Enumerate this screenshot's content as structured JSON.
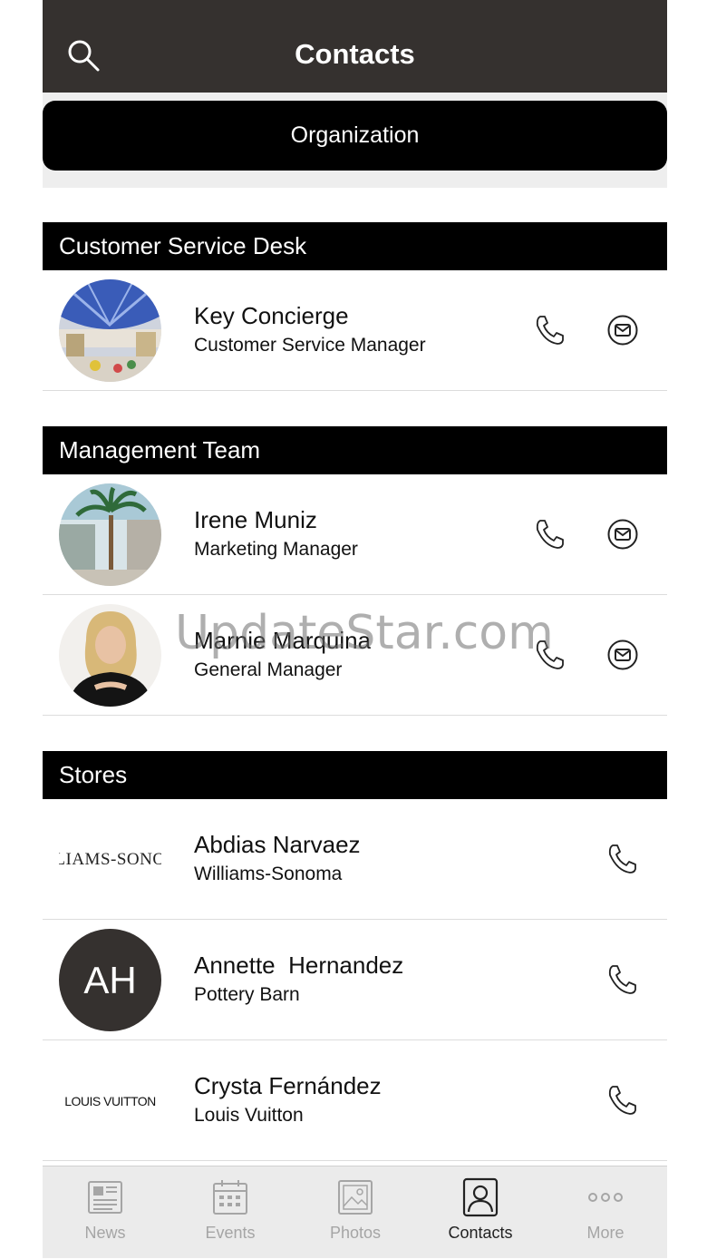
{
  "header": {
    "title": "Contacts",
    "search_icon": "search-icon"
  },
  "org_button": {
    "label": "Organization"
  },
  "sections": [
    {
      "title": "Customer Service Desk"
    },
    {
      "title": "Management Team"
    },
    {
      "title": "Stores"
    }
  ],
  "contacts": {
    "key": {
      "name": "Key Concierge",
      "role": "Customer Service Manager"
    },
    "irene": {
      "name": "Irene Muniz",
      "role": "Marketing Manager"
    },
    "marnie": {
      "name": "Marnie Marquina",
      "role": "General Manager"
    },
    "abdias": {
      "name": "Abdias Narvaez",
      "role": "Williams-Sonoma",
      "logo_text": "LIAMS-SONO"
    },
    "annette": {
      "name": "Annette  Hernandez",
      "role": "Pottery Barn",
      "initials": "AH"
    },
    "crysta": {
      "name": "Crysta Fernández",
      "role": "Louis Vuitton",
      "logo_text": "LOUIS VUITTON"
    }
  },
  "tabs": [
    {
      "label": "News"
    },
    {
      "label": "Events"
    },
    {
      "label": "Photos"
    },
    {
      "label": "Contacts"
    },
    {
      "label": "More"
    }
  ],
  "watermark": "UpdateStar.com",
  "colors": {
    "header_bg": "#35312f",
    "section_bg": "#000000",
    "tab_active": "#222222",
    "tab_inactive": "#a5a5a5"
  }
}
